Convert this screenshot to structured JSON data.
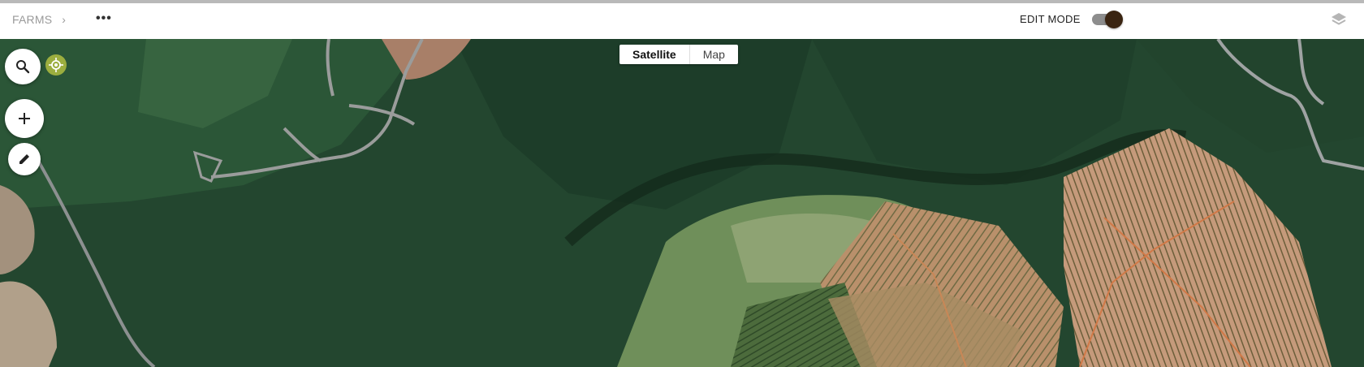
{
  "header": {
    "breadcrumb": "FARMS",
    "breadcrumb_chevron": "›",
    "more_icon": "•••",
    "edit_mode_label": "EDIT MODE",
    "edit_mode_on": true
  },
  "map": {
    "view_toggle": {
      "options": [
        "Satellite",
        "Map"
      ],
      "selected": "Satellite"
    },
    "controls": [
      "search-icon",
      "locate-icon",
      "add-icon",
      "pencil-icon"
    ],
    "layers_icon": "layers-icon"
  },
  "colors": {
    "forest": "#23462f",
    "toggle_knob": "#3a2411",
    "locate_button": "#9cae3f"
  }
}
